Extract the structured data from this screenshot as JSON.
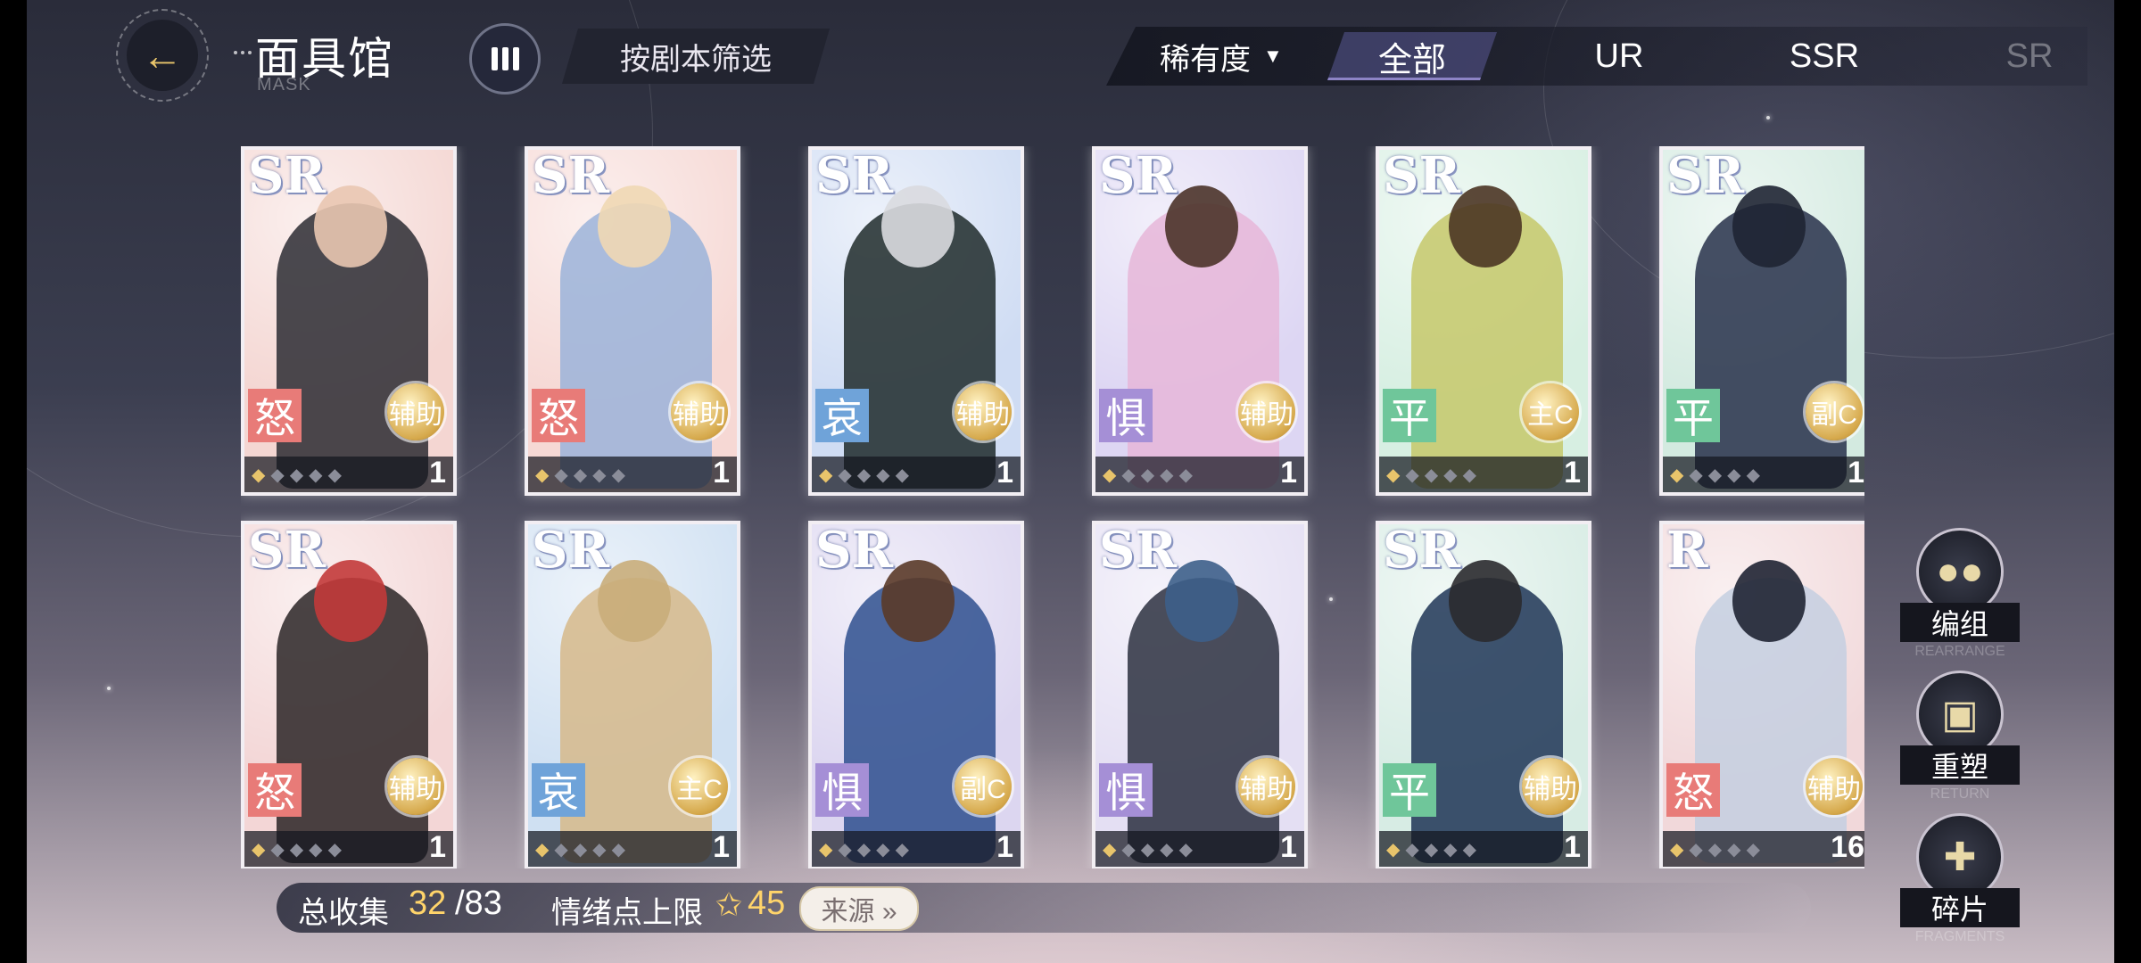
{
  "header": {
    "title": "面具馆",
    "subtitle": "MASK",
    "back_icon": "←",
    "script_filter_label": "按剧本筛选",
    "rarity_dropdown_label": "稀有度",
    "rarity_dropdown_caret": "▼",
    "rarity_tabs": [
      {
        "label": "全部",
        "selected": true
      },
      {
        "label": "UR",
        "selected": false
      },
      {
        "label": "SSR",
        "selected": false
      },
      {
        "label": "SR",
        "selected": false
      }
    ]
  },
  "cards": [
    {
      "rarity": "SR",
      "emotion": "怒",
      "role": "辅助",
      "count": "1",
      "bg": "#f4d6d2",
      "emotion_color": "#e87b78",
      "fig": "#2b2b33",
      "head": "#e9c7b1"
    },
    {
      "rarity": "SR",
      "emotion": "怒",
      "role": "辅助",
      "count": "1",
      "bg": "#f6d8d4",
      "emotion_color": "#e87b78",
      "fig": "#9bb3d9",
      "head": "#f0d8b4"
    },
    {
      "rarity": "SR",
      "emotion": "哀",
      "role": "辅助",
      "count": "1",
      "bg": "#cfdcf3",
      "emotion_color": "#6fa3d9",
      "fig": "#1f2a2a",
      "head": "#d9dadf"
    },
    {
      "rarity": "SR",
      "emotion": "惧",
      "role": "辅助",
      "count": "1",
      "bg": "#ddd6f3",
      "emotion_color": "#a58fd6",
      "fig": "#e6b6d8",
      "head": "#4b3329"
    },
    {
      "rarity": "SR",
      "emotion": "平",
      "role": "主C",
      "count": "1",
      "bg": "#d7efe2",
      "emotion_color": "#6fc69a",
      "fig": "#c6c86a",
      "head": "#4b3524"
    },
    {
      "rarity": "SR",
      "emotion": "平",
      "role": "副C",
      "count": "1",
      "bg": "#d3eae0",
      "emotion_color": "#6fc69a",
      "fig": "#27304a",
      "head": "#1f2533"
    },
    {
      "rarity": "SR",
      "emotion": "怒",
      "role": "辅助",
      "count": "1",
      "bg": "#f3d6d6",
      "emotion_color": "#e87b78",
      "fig": "#2a2426",
      "head": "#c23a3a"
    },
    {
      "rarity": "SR",
      "emotion": "哀",
      "role": "主C",
      "count": "1",
      "bg": "#cfe0f2",
      "emotion_color": "#6fa3d9",
      "fig": "#d6b98a",
      "head": "#c9ad7a"
    },
    {
      "rarity": "SR",
      "emotion": "惧",
      "role": "副C",
      "count": "1",
      "bg": "#dcd6f0",
      "emotion_color": "#a58fd6",
      "fig": "#2e4f8e",
      "head": "#5a3a28"
    },
    {
      "rarity": "SR",
      "emotion": "惧",
      "role": "辅助",
      "count": "1",
      "bg": "#e4dff3",
      "emotion_color": "#a58fd6",
      "fig": "#2b3040",
      "head": "#3d5f8a"
    },
    {
      "rarity": "SR",
      "emotion": "平",
      "role": "辅助",
      "count": "1",
      "bg": "#d7ece4",
      "emotion_color": "#6fc69a",
      "fig": "#1f3556",
      "head": "#2a2a2e"
    },
    {
      "rarity": "R",
      "emotion": "怒",
      "role": "辅助",
      "count": "16",
      "bg": "#f1d8da",
      "emotion_color": "#e87b78",
      "fig": "#c4cfe0",
      "head": "#1f2333"
    }
  ],
  "stats": {
    "total_label": "总收集",
    "total_value": "32",
    "total_max": "/83",
    "emotion_label": "情绪点上限",
    "emotion_icon": "✩",
    "emotion_value": "45",
    "source_label": "来源 »"
  },
  "side_buttons": [
    {
      "label": "编组",
      "sub": "REARRANGE",
      "icon": "group-icon"
    },
    {
      "label": "重塑",
      "sub": "RETURN",
      "icon": "reshape-icon"
    },
    {
      "label": "碎片",
      "sub": "FRAGMENTS",
      "icon": "puzzle-icon"
    }
  ]
}
